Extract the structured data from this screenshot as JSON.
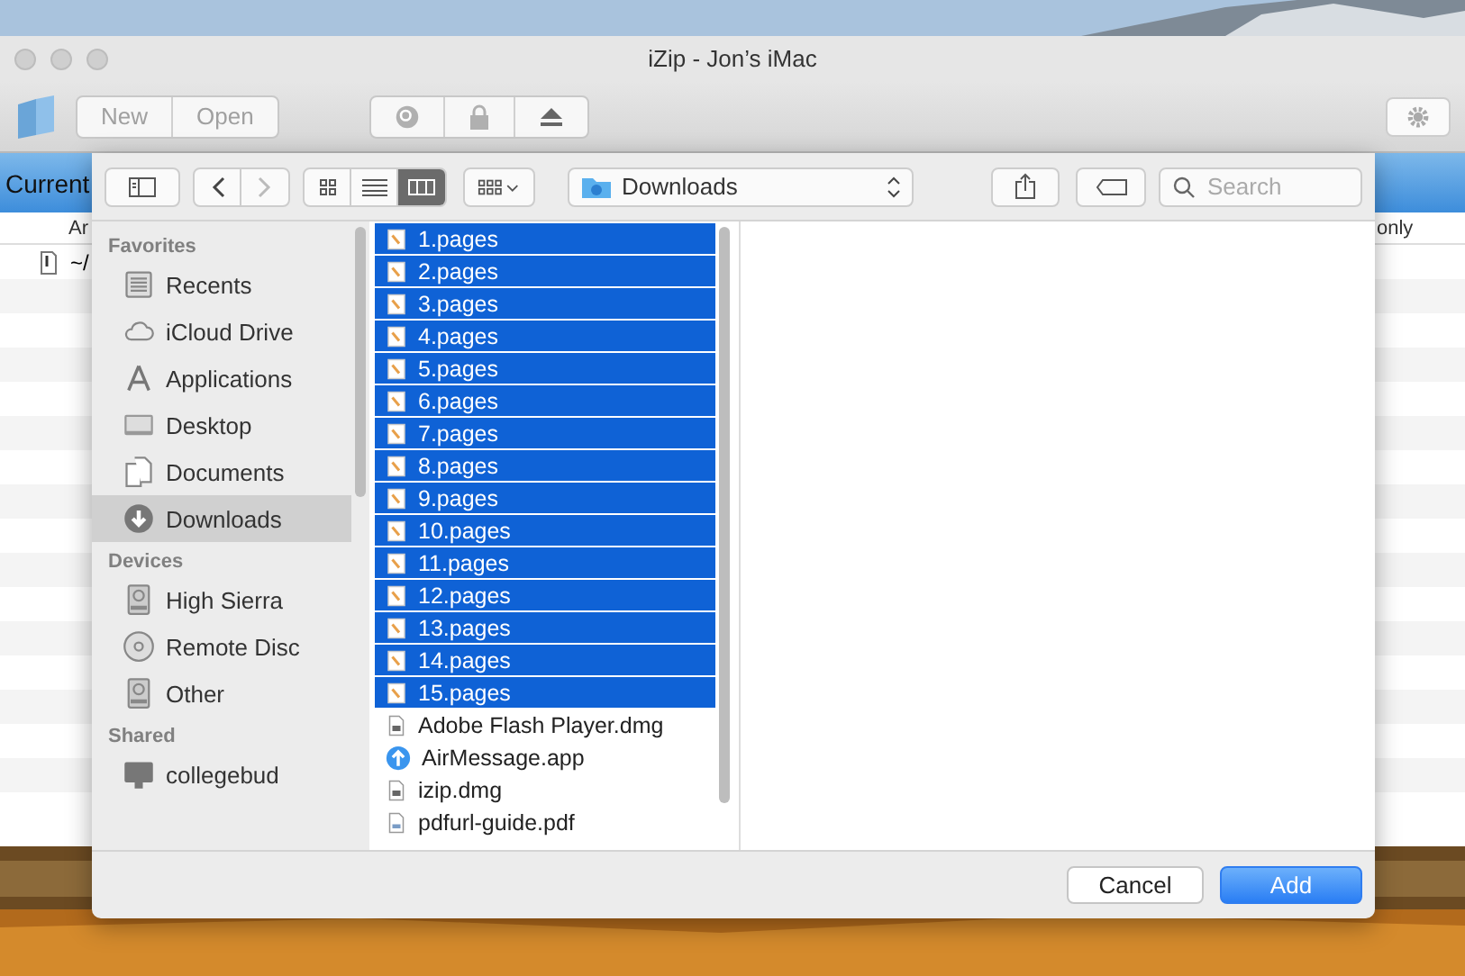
{
  "window": {
    "title": "iZip - Jon’s iMac"
  },
  "toolbar": {
    "buttons": [
      "New",
      "Open"
    ]
  },
  "archive": {
    "header": "Current",
    "columns": [
      "Ar",
      "only"
    ],
    "rows": [
      {
        "path": "~/"
      }
    ]
  },
  "dialog": {
    "location": "Downloads",
    "search": {
      "placeholder": "Search"
    },
    "sidebar": [
      {
        "heading": "Favorites",
        "items": [
          {
            "label": "Recents",
            "kind": "recents",
            "selected": false
          },
          {
            "label": "iCloud Drive",
            "kind": "cloud",
            "selected": false
          },
          {
            "label": "Applications",
            "kind": "apps",
            "selected": false
          },
          {
            "label": "Desktop",
            "kind": "desktop",
            "selected": false
          },
          {
            "label": "Documents",
            "kind": "documents",
            "selected": false
          },
          {
            "label": "Downloads",
            "kind": "downloads",
            "selected": true
          }
        ]
      },
      {
        "heading": "Devices",
        "items": [
          {
            "label": "High Sierra",
            "kind": "disk",
            "selected": false
          },
          {
            "label": "Remote Disc",
            "kind": "disc",
            "selected": false
          },
          {
            "label": "Other",
            "kind": "disk",
            "selected": false
          }
        ]
      },
      {
        "heading": "Shared",
        "items": [
          {
            "label": "collegebud",
            "kind": "computer",
            "selected": false
          }
        ]
      }
    ],
    "files": [
      {
        "name": "1.pages",
        "kind": "pages",
        "selected": true
      },
      {
        "name": "2.pages",
        "kind": "pages",
        "selected": true
      },
      {
        "name": "3.pages",
        "kind": "pages",
        "selected": true
      },
      {
        "name": "4.pages",
        "kind": "pages",
        "selected": true
      },
      {
        "name": "5.pages",
        "kind": "pages",
        "selected": true
      },
      {
        "name": "6.pages",
        "kind": "pages",
        "selected": true
      },
      {
        "name": "7.pages",
        "kind": "pages",
        "selected": true
      },
      {
        "name": "8.pages",
        "kind": "pages",
        "selected": true
      },
      {
        "name": "9.pages",
        "kind": "pages",
        "selected": true
      },
      {
        "name": "10.pages",
        "kind": "pages",
        "selected": true
      },
      {
        "name": "11.pages",
        "kind": "pages",
        "selected": true
      },
      {
        "name": "12.pages",
        "kind": "pages",
        "selected": true
      },
      {
        "name": "13.pages",
        "kind": "pages",
        "selected": true
      },
      {
        "name": "14.pages",
        "kind": "pages",
        "selected": true
      },
      {
        "name": "15.pages",
        "kind": "pages",
        "selected": true
      },
      {
        "name": "Adobe Flash Player.dmg",
        "kind": "dmg",
        "selected": false
      },
      {
        "name": "AirMessage.app",
        "kind": "app",
        "selected": false
      },
      {
        "name": "izip.dmg",
        "kind": "dmg",
        "selected": false
      },
      {
        "name": "pdfurl-guide.pdf",
        "kind": "pdf",
        "selected": false
      }
    ],
    "buttons": [
      {
        "label": "Cancel",
        "kind": "secondary"
      },
      {
        "label": "Add",
        "kind": "primary"
      }
    ]
  }
}
